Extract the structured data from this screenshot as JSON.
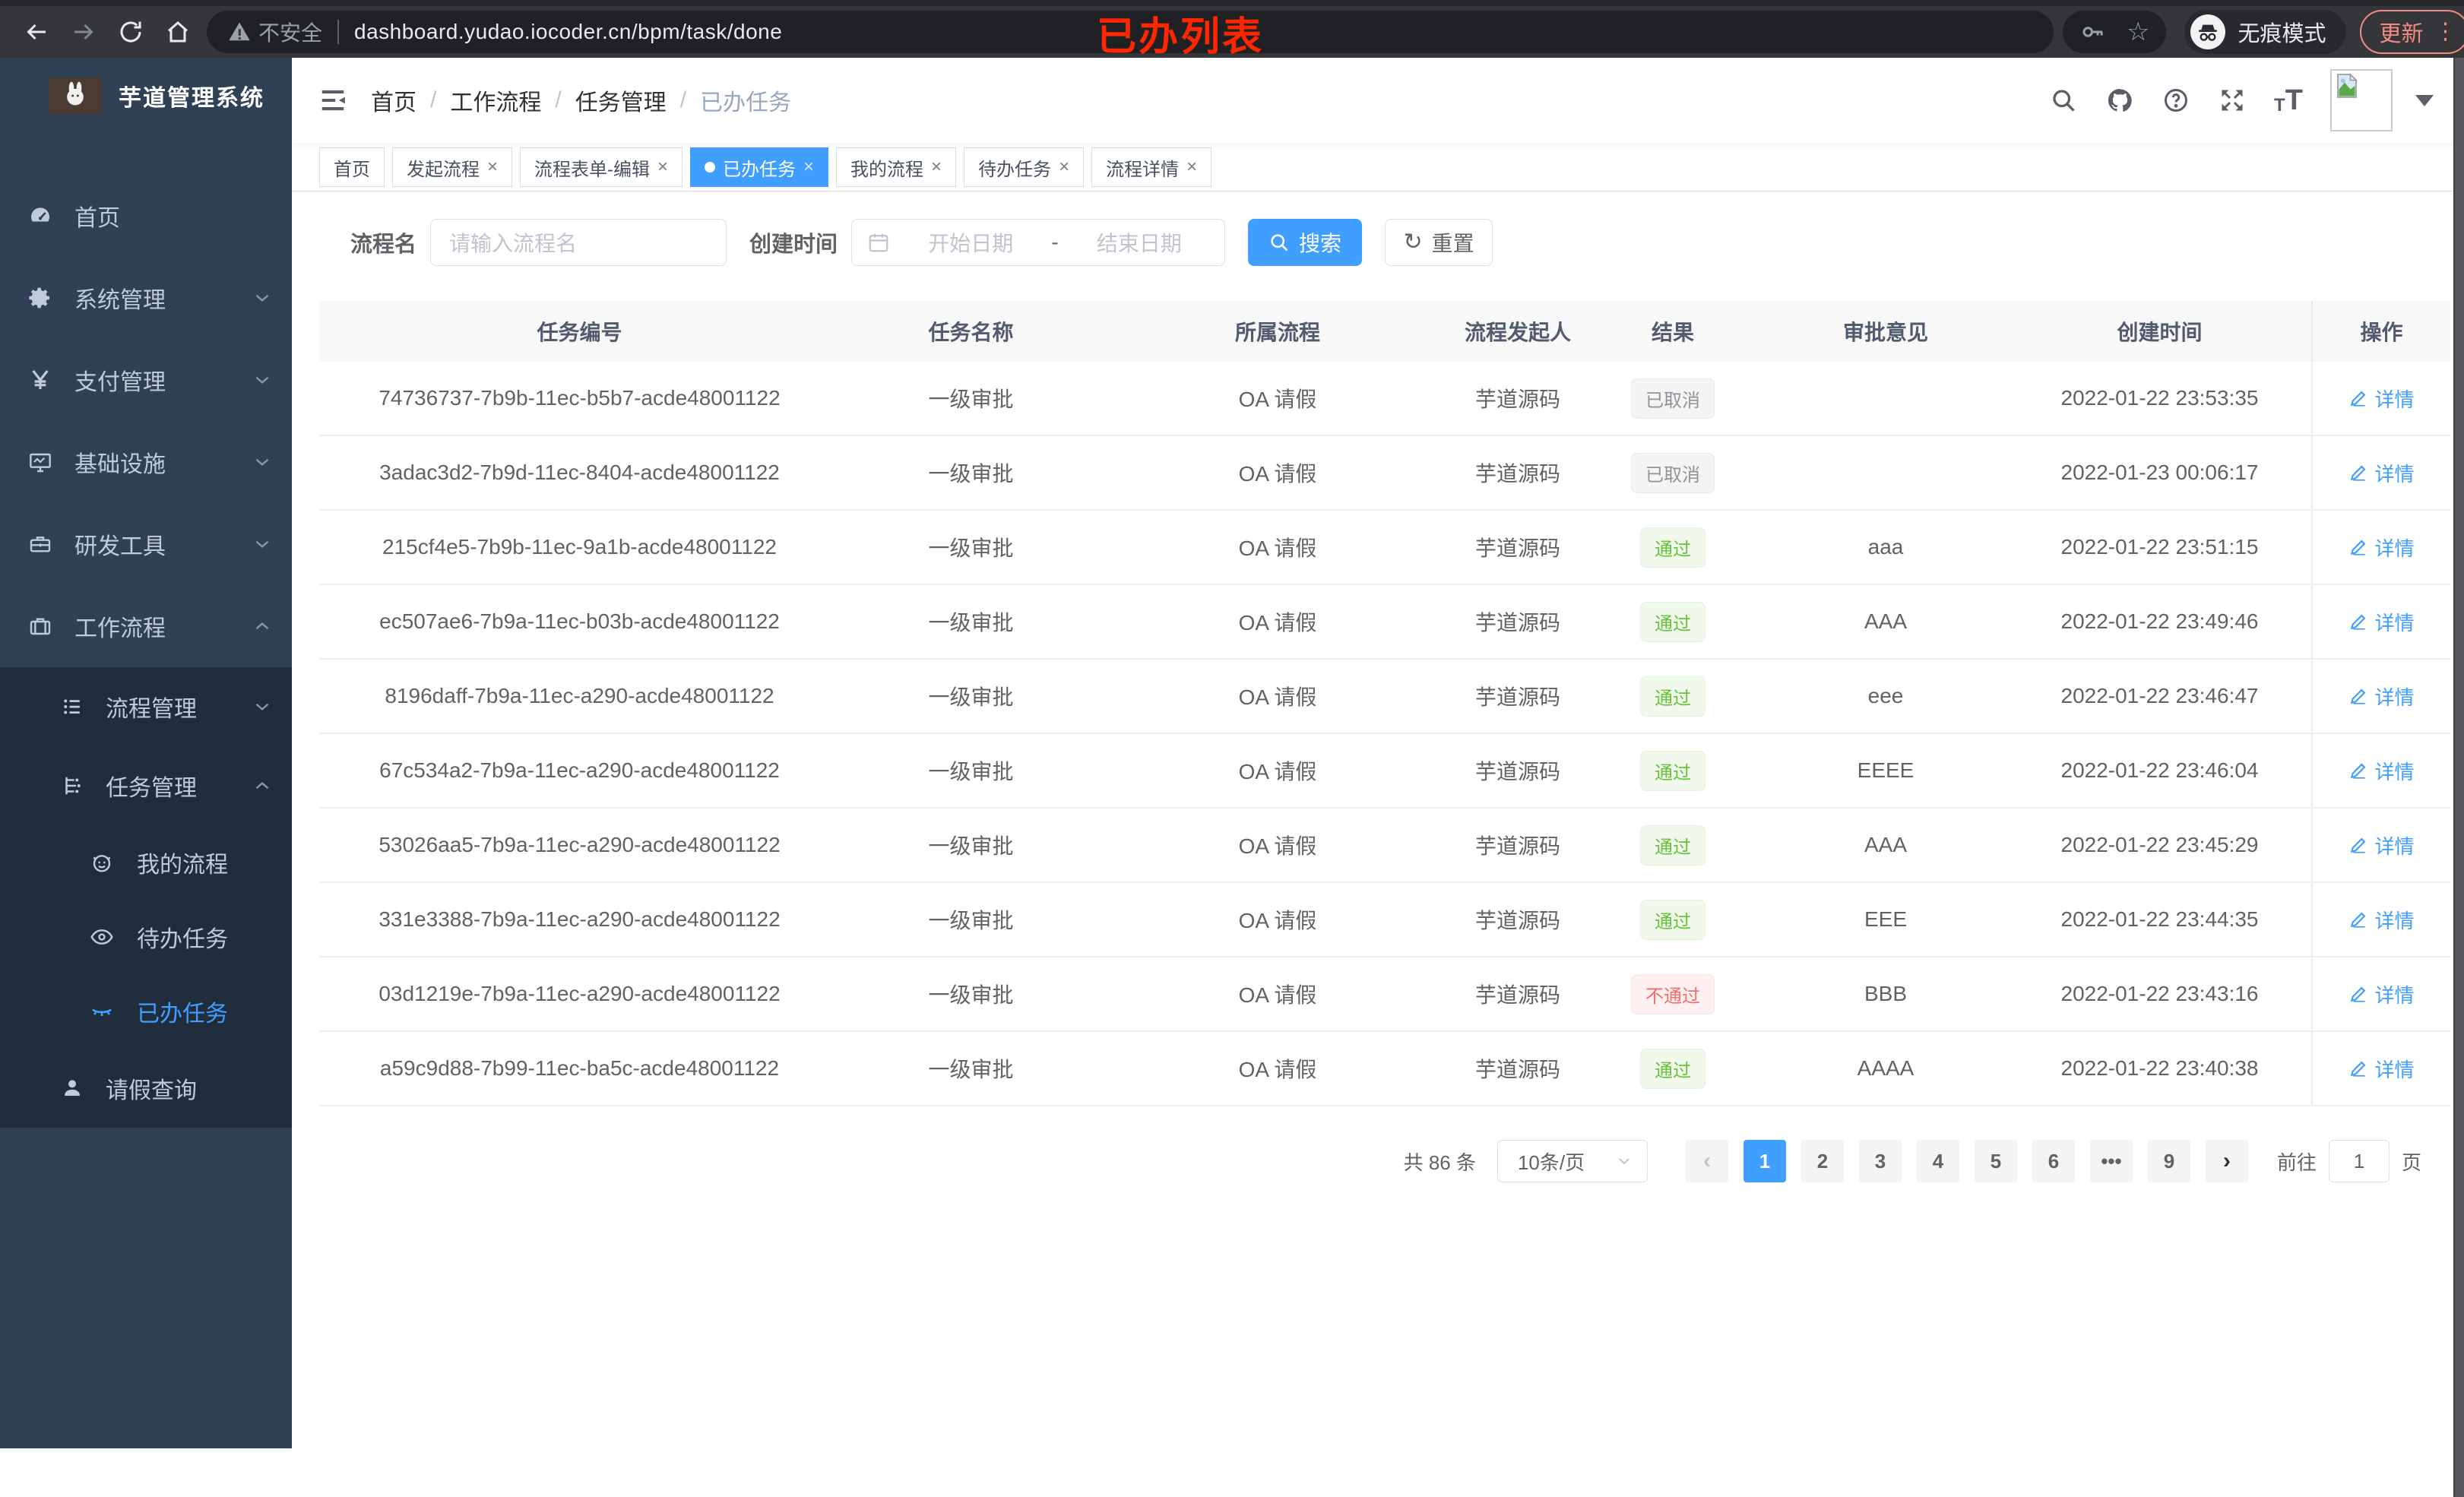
{
  "annotation": {
    "text": "已办列表",
    "color": "#ff2600"
  },
  "browser": {
    "security_label": "不安全",
    "url": "dashboard.yudao.iocoder.cn/bpm/task/done",
    "incognito_label": "无痕模式",
    "update_label": "更新"
  },
  "sidebar": {
    "title": "芋道管理系统",
    "items": [
      {
        "icon": "dashboard-icon",
        "label": "首页",
        "level": 1
      },
      {
        "icon": "gear-icon",
        "label": "系统管理",
        "level": 1,
        "chevron": "down"
      },
      {
        "icon": "yen-icon",
        "label": "支付管理",
        "level": 1,
        "chevron": "down"
      },
      {
        "icon": "monitor-icon",
        "label": "基础设施",
        "level": 1,
        "chevron": "down"
      },
      {
        "icon": "toolbox-icon",
        "label": "研发工具",
        "level": 1,
        "chevron": "down"
      },
      {
        "icon": "briefcase-icon",
        "label": "工作流程",
        "level": 1,
        "chevron": "up"
      },
      {
        "icon": "list-icon",
        "label": "流程管理",
        "level": 2,
        "chevron": "down"
      },
      {
        "icon": "tree-icon",
        "label": "任务管理",
        "level": 2,
        "chevron": "up"
      },
      {
        "icon": "robot-icon",
        "label": "我的流程",
        "level": 3
      },
      {
        "icon": "eye-icon",
        "label": "待办任务",
        "level": 3
      },
      {
        "icon": "eye-closed-icon",
        "label": "已办任务",
        "level": 3,
        "active": true
      },
      {
        "icon": "user-icon",
        "label": "请假查询",
        "level": 2
      }
    ]
  },
  "breadcrumb": [
    "首页",
    "工作流程",
    "任务管理",
    "已办任务"
  ],
  "tabs": [
    {
      "label": "首页",
      "closable": false,
      "active": false
    },
    {
      "label": "发起流程",
      "closable": true,
      "active": false
    },
    {
      "label": "流程表单-编辑",
      "closable": true,
      "active": false
    },
    {
      "label": "已办任务",
      "closable": true,
      "active": true
    },
    {
      "label": "我的流程",
      "closable": true,
      "active": false
    },
    {
      "label": "待办任务",
      "closable": true,
      "active": false
    },
    {
      "label": "流程详情",
      "closable": true,
      "active": false
    }
  ],
  "search": {
    "name_label": "流程名",
    "name_placeholder": "请输入流程名",
    "time_label": "创建时间",
    "start_placeholder": "开始日期",
    "range_separator": "-",
    "end_placeholder": "结束日期",
    "search_label": "搜索",
    "reset_label": "重置"
  },
  "table": {
    "columns": [
      "任务编号",
      "任务名称",
      "所属流程",
      "流程发起人",
      "结果",
      "审批意见",
      "创建时间",
      "操作"
    ],
    "detail_label": "详情",
    "rows": [
      {
        "id": "74736737-7b9b-11ec-b5b7-acde48001122",
        "name": "一级审批",
        "process": "OA 请假",
        "starter": "芋道源码",
        "result": "已取消",
        "result_type": "cancel",
        "opinion": "",
        "created": "2022-01-22 23:53:35"
      },
      {
        "id": "3adac3d2-7b9d-11ec-8404-acde48001122",
        "name": "一级审批",
        "process": "OA 请假",
        "starter": "芋道源码",
        "result": "已取消",
        "result_type": "cancel",
        "opinion": "",
        "created": "2022-01-23 00:06:17"
      },
      {
        "id": "215cf4e5-7b9b-11ec-9a1b-acde48001122",
        "name": "一级审批",
        "process": "OA 请假",
        "starter": "芋道源码",
        "result": "通过",
        "result_type": "pass",
        "opinion": "aaa",
        "created": "2022-01-22 23:51:15"
      },
      {
        "id": "ec507ae6-7b9a-11ec-b03b-acde48001122",
        "name": "一级审批",
        "process": "OA 请假",
        "starter": "芋道源码",
        "result": "通过",
        "result_type": "pass",
        "opinion": "AAA",
        "created": "2022-01-22 23:49:46"
      },
      {
        "id": "8196daff-7b9a-11ec-a290-acde48001122",
        "name": "一级审批",
        "process": "OA 请假",
        "starter": "芋道源码",
        "result": "通过",
        "result_type": "pass",
        "opinion": "eee",
        "created": "2022-01-22 23:46:47"
      },
      {
        "id": "67c534a2-7b9a-11ec-a290-acde48001122",
        "name": "一级审批",
        "process": "OA 请假",
        "starter": "芋道源码",
        "result": "通过",
        "result_type": "pass",
        "opinion": "EEEE",
        "created": "2022-01-22 23:46:04"
      },
      {
        "id": "53026aa5-7b9a-11ec-a290-acde48001122",
        "name": "一级审批",
        "process": "OA 请假",
        "starter": "芋道源码",
        "result": "通过",
        "result_type": "pass",
        "opinion": "AAA",
        "created": "2022-01-22 23:45:29"
      },
      {
        "id": "331e3388-7b9a-11ec-a290-acde48001122",
        "name": "一级审批",
        "process": "OA 请假",
        "starter": "芋道源码",
        "result": "通过",
        "result_type": "pass",
        "opinion": "EEE",
        "created": "2022-01-22 23:44:35"
      },
      {
        "id": "03d1219e-7b9a-11ec-a290-acde48001122",
        "name": "一级审批",
        "process": "OA 请假",
        "starter": "芋道源码",
        "result": "不通过",
        "result_type": "fail",
        "opinion": "BBB",
        "created": "2022-01-22 23:43:16"
      },
      {
        "id": "a59c9d88-7b99-11ec-ba5c-acde48001122",
        "name": "一级审批",
        "process": "OA 请假",
        "starter": "芋道源码",
        "result": "通过",
        "result_type": "pass",
        "opinion": "AAAA",
        "created": "2022-01-22 23:40:38"
      }
    ]
  },
  "pagination": {
    "total_label": "共 86 条",
    "page_size": "10条/页",
    "pages": [
      "1",
      "2",
      "3",
      "4",
      "5",
      "6",
      "•••",
      "9"
    ],
    "active_page": "1",
    "goto_label": "前往",
    "goto_value": "1",
    "page_unit": "页"
  },
  "colors": {
    "accent": "#409eff",
    "success": "#67c23a",
    "danger": "#f56c6c",
    "info": "#909399",
    "annotation_red": "#ff2600",
    "sidebar_bg": "#304156",
    "sidebar_sub_bg": "#1f2d3d"
  }
}
